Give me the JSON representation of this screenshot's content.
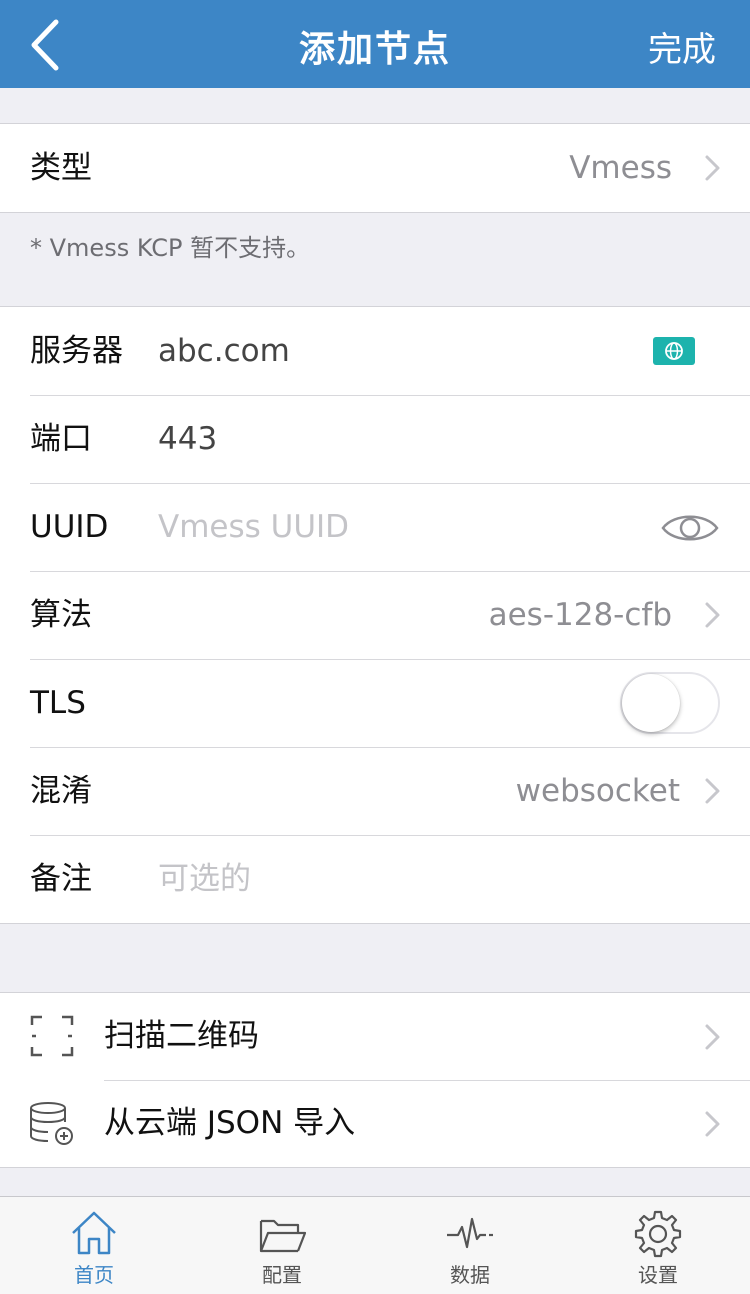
{
  "navbar": {
    "title": "添加节点",
    "done_label": "完成"
  },
  "type_row": {
    "label": "类型",
    "value": "Vmess"
  },
  "note": "* Vmess KCP 暂不支持。",
  "form": {
    "server": {
      "label": "服务器",
      "value": "abc.com"
    },
    "port": {
      "label": "端口",
      "value": "443"
    },
    "uuid": {
      "label": "UUID",
      "placeholder": "Vmess UUID"
    },
    "algorithm": {
      "label": "算法",
      "value": "aes-128-cfb"
    },
    "tls": {
      "label": "TLS",
      "enabled": false
    },
    "obfs": {
      "label": "混淆",
      "value": "websocket"
    },
    "remark": {
      "label": "备注",
      "placeholder": "可选的"
    }
  },
  "actions": [
    {
      "label": "扫描二维码",
      "icon": "scan-qr-icon"
    },
    {
      "label": "从云端 JSON 导入",
      "icon": "database-add-icon"
    }
  ],
  "tabbar": {
    "items": [
      {
        "label": "首页",
        "icon": "home-icon",
        "active": true
      },
      {
        "label": "配置",
        "icon": "folder-icon",
        "active": false
      },
      {
        "label": "数据",
        "icon": "pulse-icon",
        "active": false
      },
      {
        "label": "设置",
        "icon": "gear-icon",
        "active": false
      }
    ]
  },
  "colors": {
    "accent": "#3d86c6",
    "globe_button": "#1db3ad"
  }
}
